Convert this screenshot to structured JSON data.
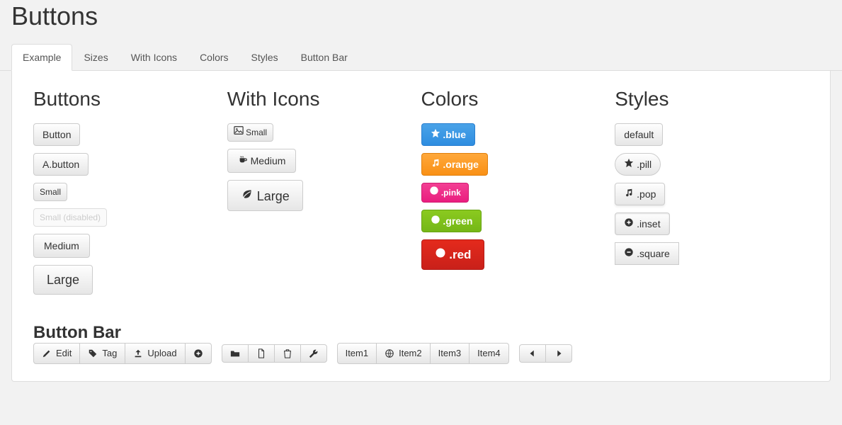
{
  "page_title": "Buttons",
  "tabs": [
    {
      "label": "Example",
      "active": true
    },
    {
      "label": "Sizes"
    },
    {
      "label": "With Icons"
    },
    {
      "label": "Colors"
    },
    {
      "label": "Styles"
    },
    {
      "label": "Button Bar"
    }
  ],
  "sections": {
    "buttons": {
      "heading": "Buttons",
      "items": [
        "Button",
        "A.button",
        "Small",
        "Small (disabled)",
        "Medium",
        "Large"
      ]
    },
    "with_icons": {
      "heading": "With Icons",
      "items": [
        {
          "label": "Small",
          "icon": "image-icon"
        },
        {
          "label": "Medium",
          "icon": "coffee-icon"
        },
        {
          "label": "Large",
          "icon": "leaf-icon"
        }
      ]
    },
    "colors": {
      "heading": "Colors",
      "items": [
        {
          "label": ".blue",
          "icon": "star-icon"
        },
        {
          "label": ".orange",
          "icon": "music-icon"
        },
        {
          "label": ".pink",
          "icon": "plus-circle-icon"
        },
        {
          "label": ".green",
          "icon": "play-circle-icon"
        },
        {
          "label": ".red",
          "icon": "minus-circle-icon"
        }
      ]
    },
    "styles": {
      "heading": "Styles",
      "items": [
        {
          "label": "default",
          "icon": null
        },
        {
          "label": ".pill",
          "icon": "star-icon"
        },
        {
          "label": ".pop",
          "icon": "music-icon"
        },
        {
          "label": ".inset",
          "icon": "plus-circle-icon"
        },
        {
          "label": ".square",
          "icon": "minus-circle-icon"
        }
      ]
    },
    "button_bar": {
      "heading": "Button Bar",
      "groups": [
        [
          {
            "label": "Edit",
            "icon": "pencil-icon"
          },
          {
            "label": "Tag",
            "icon": "tag-icon"
          },
          {
            "label": "Upload",
            "icon": "upload-icon"
          },
          {
            "label": "",
            "icon": "plus-circle-icon"
          }
        ],
        [
          {
            "label": "",
            "icon": "folder-open-icon"
          },
          {
            "label": "",
            "icon": "file-icon"
          },
          {
            "label": "",
            "icon": "trash-icon"
          },
          {
            "label": "",
            "icon": "wrench-icon"
          }
        ],
        [
          {
            "label": "Item1",
            "icon": null
          },
          {
            "label": "Item2",
            "icon": "globe-icon"
          },
          {
            "label": "Item3",
            "icon": null
          },
          {
            "label": "Item4",
            "icon": null
          }
        ],
        [
          {
            "label": "",
            "icon": "caret-left-icon"
          },
          {
            "label": "",
            "icon": "caret-right-icon"
          }
        ]
      ]
    }
  },
  "colors_palette": {
    "blue": "#3b97e3",
    "orange": "#f99320",
    "pink": "#ea2484",
    "green": "#7cbf1a",
    "red": "#d0201a"
  }
}
